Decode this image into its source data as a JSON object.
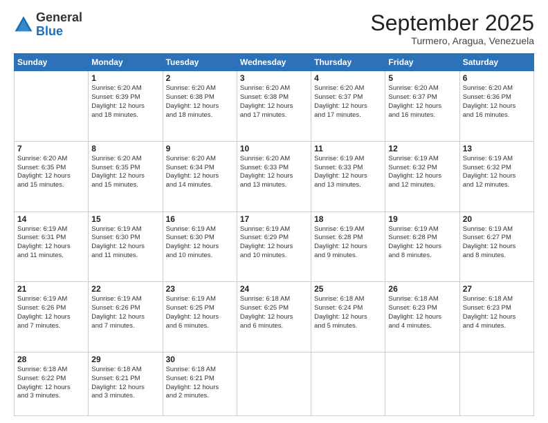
{
  "header": {
    "logo": {
      "general": "General",
      "blue": "Blue"
    },
    "title": "September 2025",
    "location": "Turmero, Aragua, Venezuela"
  },
  "calendar": {
    "days_of_week": [
      "Sunday",
      "Monday",
      "Tuesday",
      "Wednesday",
      "Thursday",
      "Friday",
      "Saturday"
    ],
    "weeks": [
      [
        {
          "day": "",
          "info": ""
        },
        {
          "day": "1",
          "info": "Sunrise: 6:20 AM\nSunset: 6:39 PM\nDaylight: 12 hours\nand 18 minutes."
        },
        {
          "day": "2",
          "info": "Sunrise: 6:20 AM\nSunset: 6:38 PM\nDaylight: 12 hours\nand 18 minutes."
        },
        {
          "day": "3",
          "info": "Sunrise: 6:20 AM\nSunset: 6:38 PM\nDaylight: 12 hours\nand 17 minutes."
        },
        {
          "day": "4",
          "info": "Sunrise: 6:20 AM\nSunset: 6:37 PM\nDaylight: 12 hours\nand 17 minutes."
        },
        {
          "day": "5",
          "info": "Sunrise: 6:20 AM\nSunset: 6:37 PM\nDaylight: 12 hours\nand 16 minutes."
        },
        {
          "day": "6",
          "info": "Sunrise: 6:20 AM\nSunset: 6:36 PM\nDaylight: 12 hours\nand 16 minutes."
        }
      ],
      [
        {
          "day": "7",
          "info": "Sunrise: 6:20 AM\nSunset: 6:35 PM\nDaylight: 12 hours\nand 15 minutes."
        },
        {
          "day": "8",
          "info": "Sunrise: 6:20 AM\nSunset: 6:35 PM\nDaylight: 12 hours\nand 15 minutes."
        },
        {
          "day": "9",
          "info": "Sunrise: 6:20 AM\nSunset: 6:34 PM\nDaylight: 12 hours\nand 14 minutes."
        },
        {
          "day": "10",
          "info": "Sunrise: 6:20 AM\nSunset: 6:33 PM\nDaylight: 12 hours\nand 13 minutes."
        },
        {
          "day": "11",
          "info": "Sunrise: 6:19 AM\nSunset: 6:33 PM\nDaylight: 12 hours\nand 13 minutes."
        },
        {
          "day": "12",
          "info": "Sunrise: 6:19 AM\nSunset: 6:32 PM\nDaylight: 12 hours\nand 12 minutes."
        },
        {
          "day": "13",
          "info": "Sunrise: 6:19 AM\nSunset: 6:32 PM\nDaylight: 12 hours\nand 12 minutes."
        }
      ],
      [
        {
          "day": "14",
          "info": "Sunrise: 6:19 AM\nSunset: 6:31 PM\nDaylight: 12 hours\nand 11 minutes."
        },
        {
          "day": "15",
          "info": "Sunrise: 6:19 AM\nSunset: 6:30 PM\nDaylight: 12 hours\nand 11 minutes."
        },
        {
          "day": "16",
          "info": "Sunrise: 6:19 AM\nSunset: 6:30 PM\nDaylight: 12 hours\nand 10 minutes."
        },
        {
          "day": "17",
          "info": "Sunrise: 6:19 AM\nSunset: 6:29 PM\nDaylight: 12 hours\nand 10 minutes."
        },
        {
          "day": "18",
          "info": "Sunrise: 6:19 AM\nSunset: 6:28 PM\nDaylight: 12 hours\nand 9 minutes."
        },
        {
          "day": "19",
          "info": "Sunrise: 6:19 AM\nSunset: 6:28 PM\nDaylight: 12 hours\nand 8 minutes."
        },
        {
          "day": "20",
          "info": "Sunrise: 6:19 AM\nSunset: 6:27 PM\nDaylight: 12 hours\nand 8 minutes."
        }
      ],
      [
        {
          "day": "21",
          "info": "Sunrise: 6:19 AM\nSunset: 6:26 PM\nDaylight: 12 hours\nand 7 minutes."
        },
        {
          "day": "22",
          "info": "Sunrise: 6:19 AM\nSunset: 6:26 PM\nDaylight: 12 hours\nand 7 minutes."
        },
        {
          "day": "23",
          "info": "Sunrise: 6:19 AM\nSunset: 6:25 PM\nDaylight: 12 hours\nand 6 minutes."
        },
        {
          "day": "24",
          "info": "Sunrise: 6:18 AM\nSunset: 6:25 PM\nDaylight: 12 hours\nand 6 minutes."
        },
        {
          "day": "25",
          "info": "Sunrise: 6:18 AM\nSunset: 6:24 PM\nDaylight: 12 hours\nand 5 minutes."
        },
        {
          "day": "26",
          "info": "Sunrise: 6:18 AM\nSunset: 6:23 PM\nDaylight: 12 hours\nand 4 minutes."
        },
        {
          "day": "27",
          "info": "Sunrise: 6:18 AM\nSunset: 6:23 PM\nDaylight: 12 hours\nand 4 minutes."
        }
      ],
      [
        {
          "day": "28",
          "info": "Sunrise: 6:18 AM\nSunset: 6:22 PM\nDaylight: 12 hours\nand 3 minutes."
        },
        {
          "day": "29",
          "info": "Sunrise: 6:18 AM\nSunset: 6:21 PM\nDaylight: 12 hours\nand 3 minutes."
        },
        {
          "day": "30",
          "info": "Sunrise: 6:18 AM\nSunset: 6:21 PM\nDaylight: 12 hours\nand 2 minutes."
        },
        {
          "day": "",
          "info": ""
        },
        {
          "day": "",
          "info": ""
        },
        {
          "day": "",
          "info": ""
        },
        {
          "day": "",
          "info": ""
        }
      ]
    ]
  }
}
